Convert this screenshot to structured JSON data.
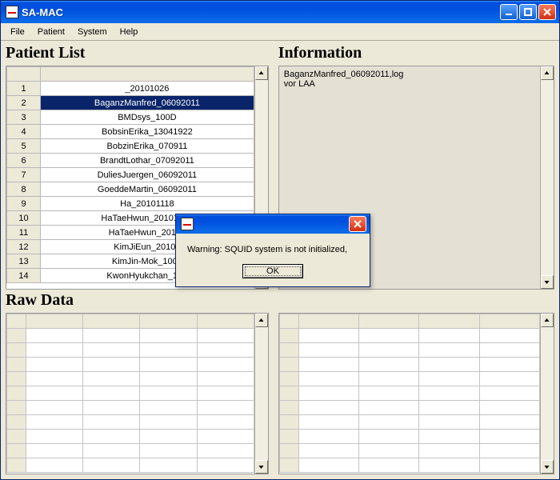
{
  "window": {
    "title": "SA-MAC"
  },
  "menubar": {
    "items": [
      "File",
      "Patient",
      "System",
      "Help"
    ]
  },
  "sections": {
    "patient_list": "Patient List",
    "information": "Information",
    "raw_data": "Raw Data"
  },
  "patient_table": {
    "selected_index": 1,
    "rows": [
      {
        "num": "1",
        "name": "_20101026"
      },
      {
        "num": "2",
        "name": "BaganzManfred_06092011"
      },
      {
        "num": "3",
        "name": "BMDsys_100D"
      },
      {
        "num": "4",
        "name": "BobsinErika_13041922"
      },
      {
        "num": "5",
        "name": "BobzinErika_070911"
      },
      {
        "num": "6",
        "name": "BrandtLothar_07092011"
      },
      {
        "num": "7",
        "name": "DuliesJuergen_06092011"
      },
      {
        "num": "8",
        "name": "GoeddeMartin_06092011"
      },
      {
        "num": "9",
        "name": "Ha_20101118"
      },
      {
        "num": "10",
        "name": "HaTaeHwun_20101203"
      },
      {
        "num": "11",
        "name": "HaTaeHwun_20101"
      },
      {
        "num": "12",
        "name": "KimJiEun_20101"
      },
      {
        "num": "13",
        "name": "KimJin-Mok_1009"
      },
      {
        "num": "14",
        "name": "KwonHyukchan_100"
      }
    ]
  },
  "information_text": "BaganzManfred_06092011,log\nvor LAA",
  "dialog": {
    "message": "Warning: SQUID system is not initialized,",
    "ok_label": "OK"
  }
}
